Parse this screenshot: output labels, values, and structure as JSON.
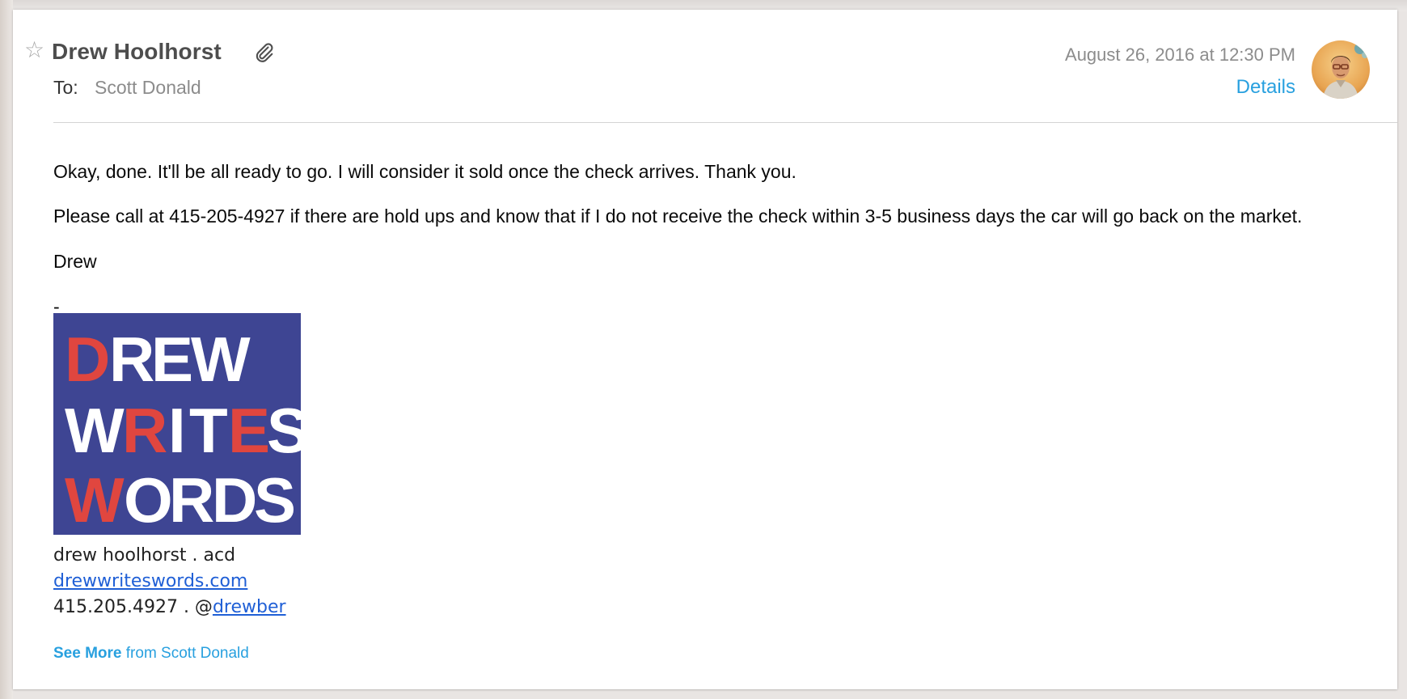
{
  "email": {
    "sender": "Drew Hoolhorst",
    "to_label": "To:",
    "to": "Scott Donald",
    "date": "August 26, 2016 at 12:30 PM",
    "details_label": "Details",
    "has_attachment": true,
    "starred": false
  },
  "body": {
    "paragraphs": [
      "Okay, done. It'll be all ready to go. I will consider it sold once the check arrives. Thank you.",
      "Please call at 415-205-4927 if there are hold ups and know that if I do not receive the check within 3-5 business days the car will go back on the market.",
      "Drew",
      "-"
    ]
  },
  "signature": {
    "logo": {
      "lines": [
        "DREW",
        "WRITES",
        "WORDS"
      ],
      "bg_color": "#3e4593",
      "text_color": "#ffffff",
      "accent_color": "#e0463f"
    },
    "name_line": "drew hoolhorst . acd",
    "website": "drewwriteswords.com",
    "phone_prefix": "415.205.4927 . @",
    "handle": "drewber"
  },
  "footer": {
    "see_more_label": "See More",
    "see_more_from": "from Scott Donald"
  },
  "colors": {
    "link_blue": "#28a0df",
    "sig_link_blue": "#1f5fd6",
    "sender_gray": "#4d4d4d",
    "meta_gray": "#8c8c8c"
  }
}
